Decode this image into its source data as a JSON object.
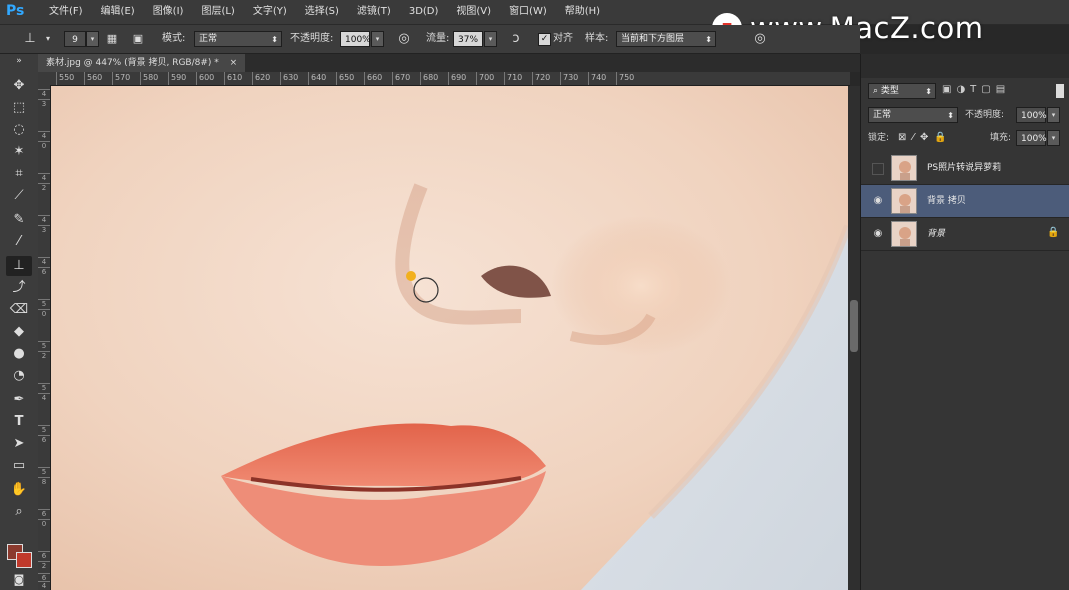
{
  "app": {
    "logo": "Ps"
  },
  "menu": [
    "文件(F)",
    "编辑(E)",
    "图像(I)",
    "图层(L)",
    "文字(Y)",
    "选择(S)",
    "滤镜(T)",
    "3D(D)",
    "视图(V)",
    "窗口(W)",
    "帮助(H)"
  ],
  "options": {
    "brush_size": "9",
    "mode_label": "模式:",
    "mode_value": "正常",
    "opacity_label": "不透明度:",
    "opacity_value": "100%",
    "flow_label": "流量:",
    "flow_value": "37%",
    "align_label": "对齐",
    "sample_label": "样本:",
    "sample_value": "当前和下方图层"
  },
  "document_tab": {
    "title": "素材.jpg @ 447% (背景 拷贝, RGB/8#) *",
    "close": "×"
  },
  "ruler_top": [
    "550",
    "560",
    "570",
    "580",
    "590",
    "600",
    "610",
    "620",
    "630",
    "640",
    "650",
    "660",
    "670",
    "680",
    "690",
    "700",
    "710",
    "720",
    "730",
    "740",
    "750"
  ],
  "ruler_left": [
    "4",
    "3",
    "4",
    "0",
    "4",
    "2",
    "4",
    "3",
    "4",
    "6",
    "5",
    "0",
    "5",
    "2",
    "5",
    "4",
    "5",
    "6",
    "5",
    "8",
    "6",
    "0",
    "6",
    "2",
    "6",
    "4"
  ],
  "layers_panel": {
    "filter_label": "类型",
    "blend_mode": "正常",
    "opacity_label": "不透明度:",
    "opacity_value": "100%",
    "lock_label": "锁定:",
    "fill_label": "填充:",
    "fill_value": "100%",
    "layers": [
      {
        "name": "PS照片转说异萝莉",
        "visible": false,
        "selected": false
      },
      {
        "name": "背景 拷贝",
        "visible": true,
        "selected": true
      },
      {
        "name": "背景",
        "visible": true,
        "selected": false,
        "locked": true
      }
    ]
  },
  "watermark": {
    "badge": "z",
    "text": "www.MacZ.com"
  },
  "colors": {
    "accent_selected_layer": "#4c5c7a",
    "foreground_swatch": "#c0392b",
    "background_swatch": "#8b3a2e"
  }
}
